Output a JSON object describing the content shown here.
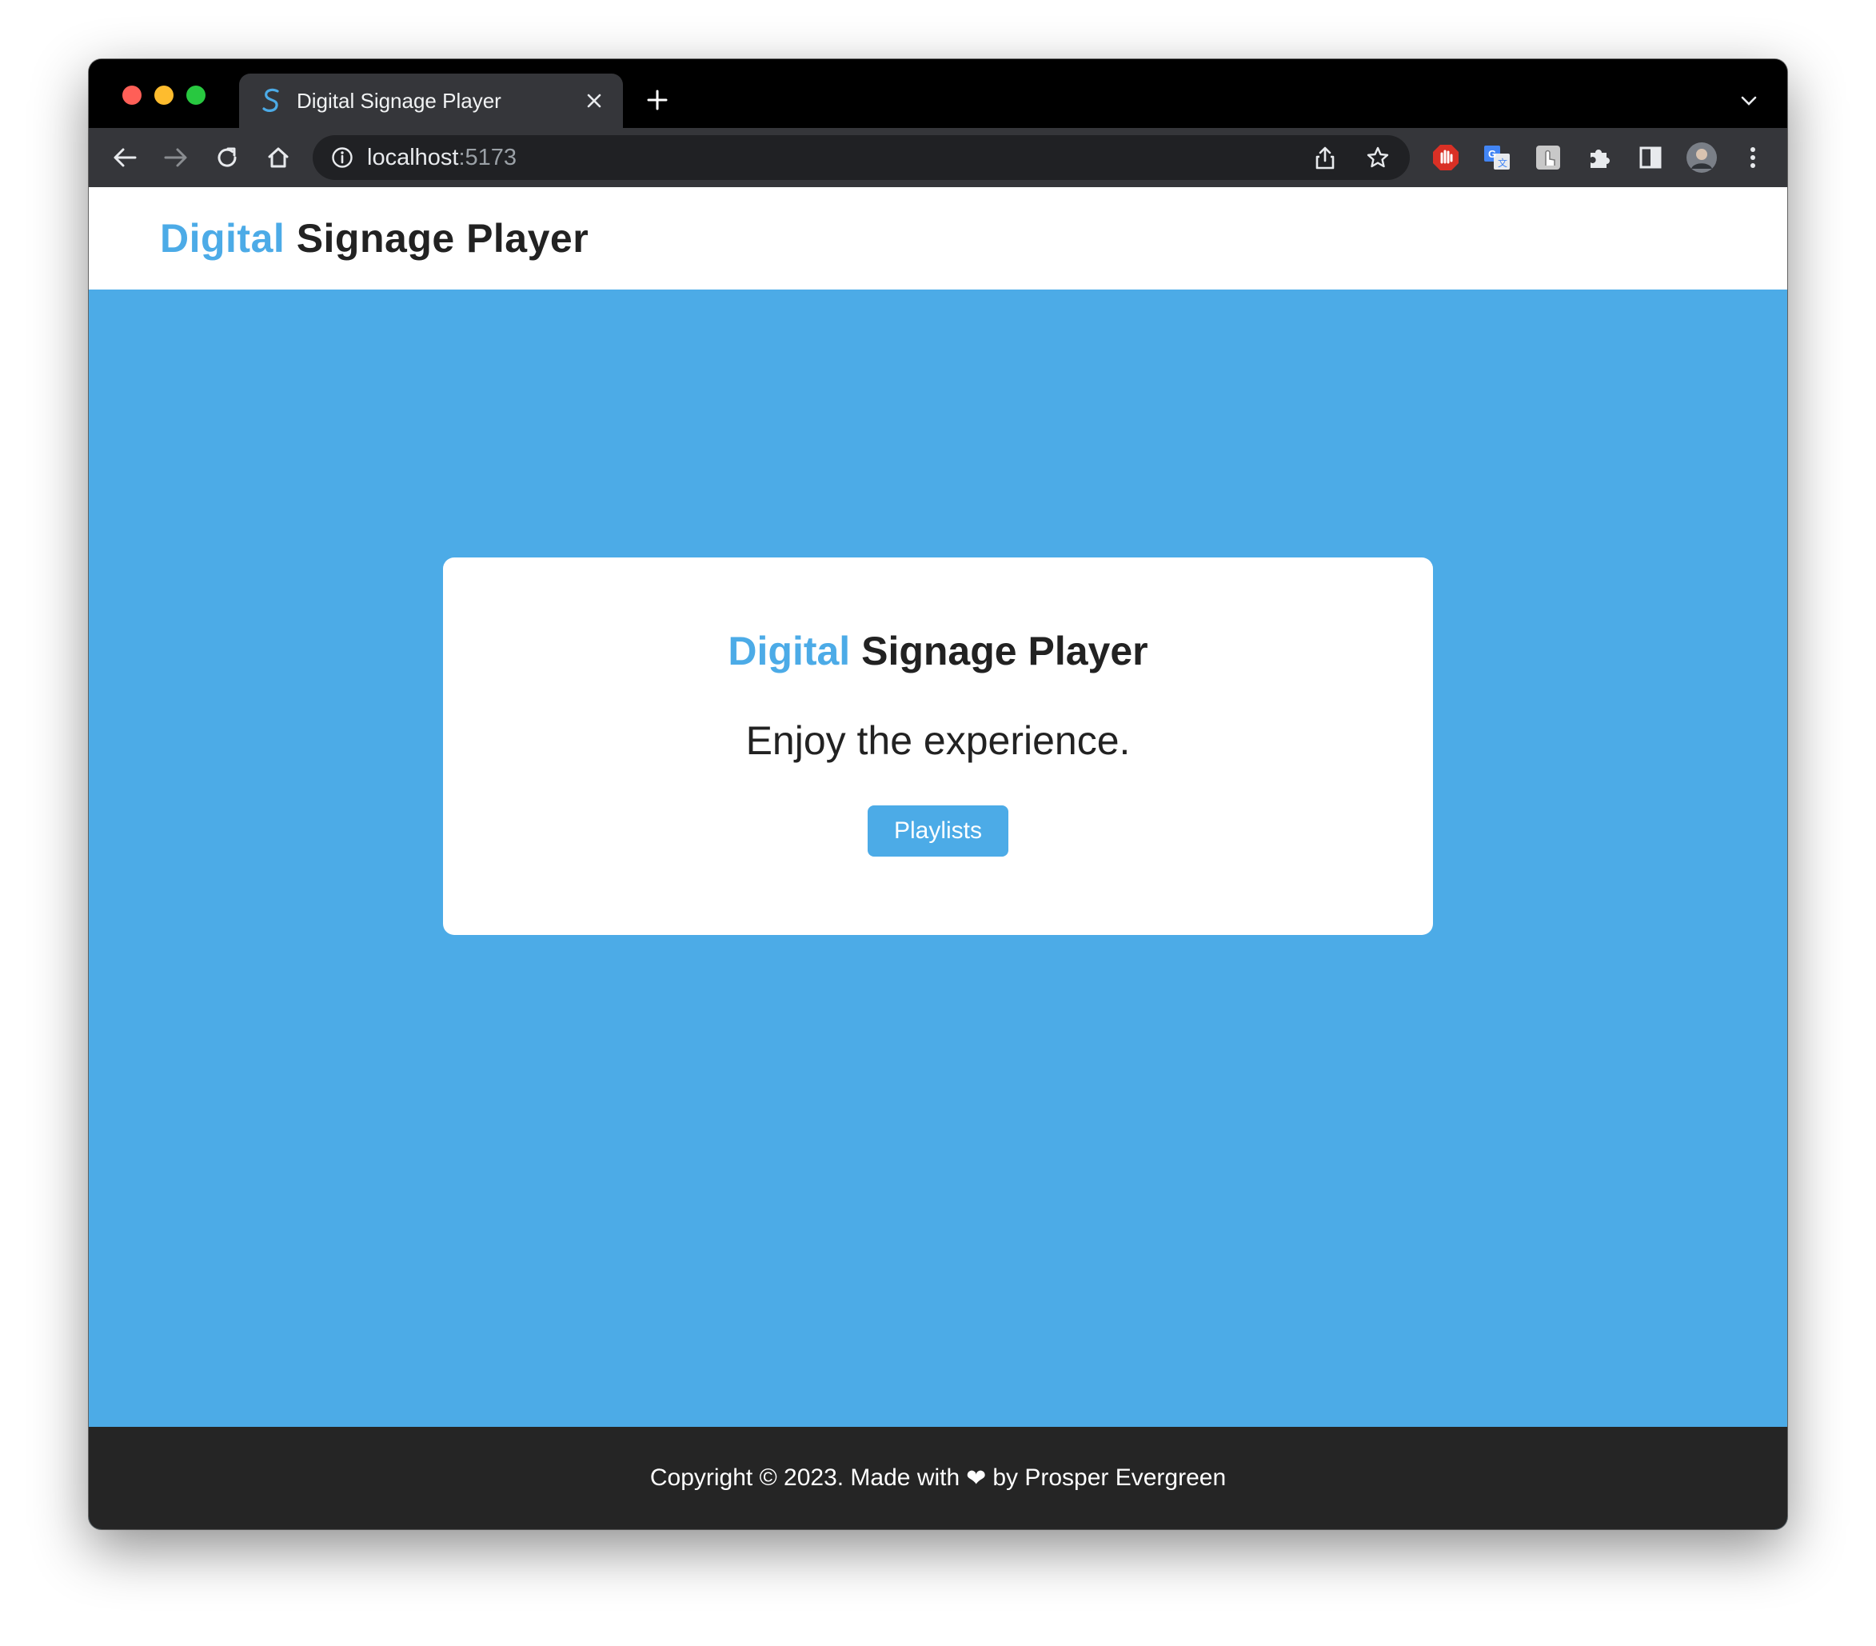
{
  "browser": {
    "tab": {
      "title": "Digital Signage Player",
      "favicon": "S"
    },
    "url": {
      "host": "localhost",
      "port": ":5173"
    },
    "icons": {
      "back": "back-arrow-icon",
      "forward": "forward-arrow-icon",
      "reload": "reload-icon",
      "home": "home-icon",
      "info": "info-icon",
      "share": "share-icon",
      "star": "bookmark-star-icon",
      "extensions": [
        "adblock-icon",
        "translate-icon",
        "touch-extension-icon",
        "puzzle-icon",
        "side-panel-icon",
        "profile-avatar",
        "kebab-menu-icon"
      ]
    }
  },
  "header": {
    "brand_accent": "Digital",
    "brand_rest": " Signage Player"
  },
  "hero": {
    "title_accent": "Digital",
    "title_rest": " Signage Player",
    "subtitle": "Enjoy the experience.",
    "button_label": "Playlists"
  },
  "footer": {
    "before": "Copyright © 2023. Made with",
    "heart": "❤",
    "after": "by Prosper Evergreen"
  },
  "colors": {
    "accent": "#4cabe7",
    "dark_text": "#222222",
    "footer_bg": "#252525"
  }
}
